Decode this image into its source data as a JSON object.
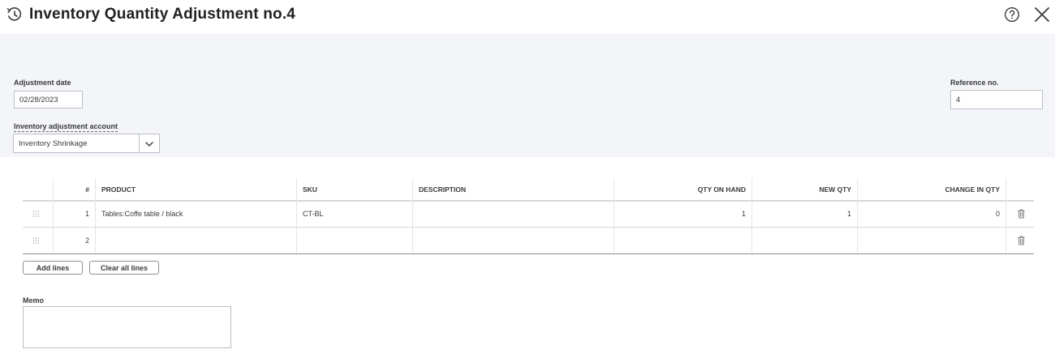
{
  "header": {
    "title": "Inventory Quantity Adjustment no.4",
    "icons": [
      "history-icon",
      "help-icon",
      "close-icon"
    ]
  },
  "form": {
    "adjustment_date_label": "Adjustment date",
    "adjustment_date_value": "02/28/2023",
    "account_label": "Inventory adjustment account",
    "account_value": "Inventory Shrinkage",
    "reference_label": "Reference no.",
    "reference_value": "4"
  },
  "table": {
    "columns": [
      "#",
      "PRODUCT",
      "SKU",
      "DESCRIPTION",
      "QTY ON HAND",
      "NEW QTY",
      "CHANGE IN QTY"
    ],
    "rows": [
      {
        "num": "1",
        "product": "Tables:Coffe table / black",
        "sku": "CT-BL",
        "description": "",
        "qty_on_hand": "1",
        "new_qty": "1",
        "change_in_qty": "0"
      },
      {
        "num": "2",
        "product": "",
        "sku": "",
        "description": "",
        "qty_on_hand": "",
        "new_qty": "",
        "change_in_qty": ""
      }
    ]
  },
  "actions": {
    "add_lines": "Add lines",
    "clear_all_lines": "Clear all lines"
  },
  "memo": {
    "label": "Memo",
    "value": ""
  },
  "colors": {
    "panel_bg": "#f4f5f8",
    "text": "#393a3d",
    "border": "#babec5"
  }
}
